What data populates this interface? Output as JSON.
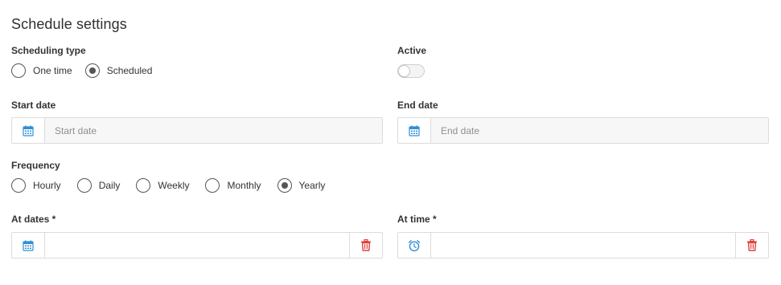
{
  "page_title": "Schedule settings",
  "scheduling_type": {
    "label": "Scheduling type",
    "options": [
      "One time",
      "Scheduled"
    ],
    "selected": "Scheduled"
  },
  "active": {
    "label": "Active",
    "on": false
  },
  "start_date": {
    "label": "Start date",
    "placeholder": "Start date",
    "value": ""
  },
  "end_date": {
    "label": "End date",
    "placeholder": "End date",
    "value": ""
  },
  "frequency": {
    "label": "Frequency",
    "options": [
      "Hourly",
      "Daily",
      "Weekly",
      "Monthly",
      "Yearly"
    ],
    "selected": "Yearly"
  },
  "at_dates": {
    "label": "At dates *",
    "value": ""
  },
  "at_time": {
    "label": "At time *",
    "value": ""
  },
  "icons": {
    "calendar": "calendar-icon",
    "clock": "alarm-clock-icon",
    "trash": "trash-icon"
  },
  "colors": {
    "accent_blue": "#2f8fd8",
    "danger_red": "#e0403a",
    "radio_checked": "#555555"
  }
}
